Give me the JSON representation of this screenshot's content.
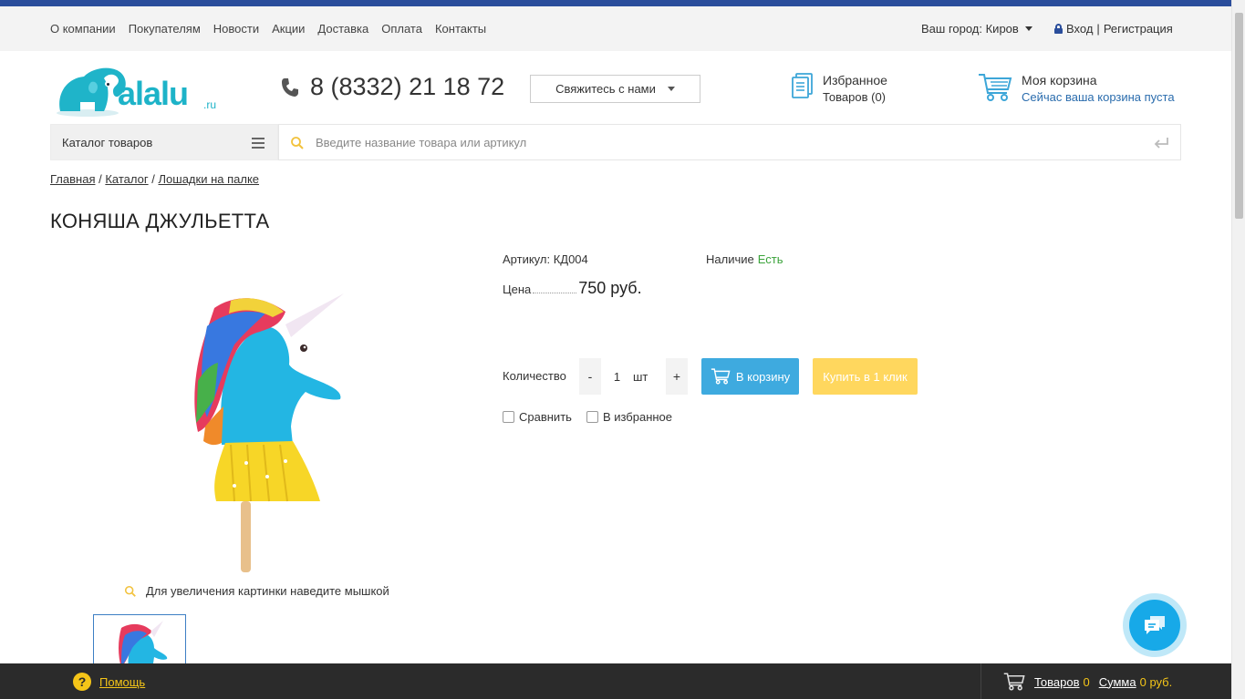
{
  "topnav": {
    "items": [
      "О компании",
      "Покупателям",
      "Новости",
      "Акции",
      "Доставка",
      "Оплата",
      "Контакты"
    ],
    "city_label": "Ваш город: Киров",
    "login": "Вход",
    "separator": "|",
    "register": "Регистрация"
  },
  "header": {
    "logo_text": "alalu",
    "logo_domain": ".ru",
    "phone": "8 (8332) 21 18 72",
    "contact_button": "Свяжитесь с нами",
    "favorites_title": "Избранное",
    "favorites_count": "Товаров (0)",
    "cart_title": "Моя корзина",
    "cart_status": "Сейчас ваша корзина пуста"
  },
  "catalog": {
    "label": "Каталог товаров"
  },
  "search": {
    "placeholder": "Введите название товара или артикул"
  },
  "breadcrumb": {
    "items": [
      "Главная",
      "Каталог",
      "Лошадки на палке"
    ],
    "separator": "/"
  },
  "product": {
    "title": "КОНЯША ДЖУЛЬЕТТА",
    "article": "Артикул: КД004",
    "stock_label": "Наличие",
    "stock_value": "Есть",
    "price_label": "Цена",
    "price": "750 руб.",
    "quantity_label": "Количество",
    "quantity_minus": "-",
    "quantity_value": "1",
    "quantity_unit": "шт",
    "quantity_plus": "+",
    "add_to_cart": "В корзину",
    "buy_one_click": "Купить в 1 клик",
    "compare": "Сравнить",
    "favorite": "В избранное",
    "zoom_hint": "Для увеличения картинки наведите мышкой"
  },
  "bottombar": {
    "help": "Помощь",
    "items_label": "Товаров",
    "items_count": "0",
    "sum_label": "Сумма",
    "sum_value": "0 руб."
  },
  "colors": {
    "accent_blue": "#2a4d9b",
    "cart_button": "#3eaadf",
    "oneclick_button": "#ffd75e",
    "stock_green": "#3aa33a",
    "bottom_bar": "#2b2b2b",
    "bottom_highlight": "#f5c518"
  }
}
